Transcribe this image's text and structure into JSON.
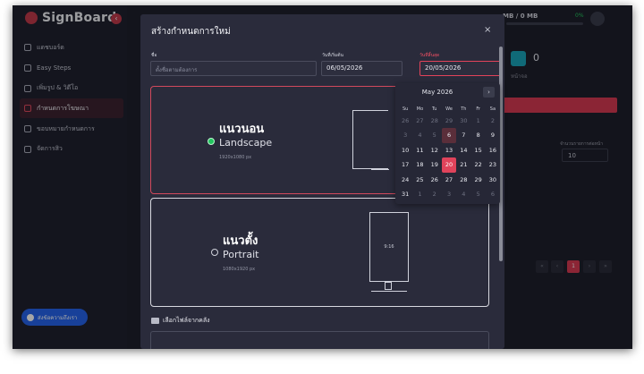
{
  "app": {
    "logo": "SignBoard"
  },
  "sidebar": {
    "items": [
      {
        "label": "แดชบอร์ด",
        "icon": "home-icon",
        "active": false
      },
      {
        "label": "Easy Steps",
        "icon": "steps-icon",
        "active": false
      },
      {
        "label": "เพิ่มรูป & วิดีโอ",
        "icon": "upload-icon",
        "active": false
      },
      {
        "label": "กำหนดการโฆษณา",
        "icon": "schedule-icon",
        "active": true
      },
      {
        "label": "ขอบหมายกำหนดการ",
        "icon": "calendar-icon",
        "active": false
      },
      {
        "label": "จัดการสิว",
        "icon": "users-icon",
        "active": false
      }
    ],
    "contact_button": "ส่งข้อความถึงเรา"
  },
  "header": {
    "storage": "MB / 0 MB",
    "storage_pct": "0%"
  },
  "background": {
    "stat_value": "0",
    "stat_label": "หน้าจอ",
    "page_size_label": "จำนวนรายการต่อหน้า",
    "page_size": "10",
    "current_page": "1"
  },
  "modal": {
    "title": "สร้างกำหนดการใหม่",
    "close": "×",
    "name_label": "ชื่อ",
    "name_placeholder": "ตั้งชื่อตามต้องการ",
    "start_label": "วันที่เริ่มต้น",
    "start_value": "06/05/2026",
    "end_label": "วันที่สิ้นสุด",
    "end_value": "20/05/2026",
    "landscape": {
      "thai": "แนวนอน",
      "english": "Landscape",
      "size": "1920x1080 px",
      "selected": true
    },
    "portrait": {
      "thai": "แนวตั้ง",
      "english": "Portrait",
      "size": "1080x1920 px",
      "ratio": "9:16",
      "selected": false
    },
    "file_section": "เลือกไฟล์จากคลัง"
  },
  "datepicker": {
    "month": "May 2026",
    "next": "›",
    "weekdays": [
      "Su",
      "Mo",
      "Tu",
      "We",
      "Th",
      "Fr",
      "Sa"
    ],
    "days": [
      {
        "d": "26",
        "muted": true
      },
      {
        "d": "27",
        "muted": true
      },
      {
        "d": "28",
        "muted": true
      },
      {
        "d": "29",
        "muted": true
      },
      {
        "d": "30",
        "muted": true
      },
      {
        "d": "1",
        "muted": true
      },
      {
        "d": "2",
        "muted": true
      },
      {
        "d": "3",
        "muted": true
      },
      {
        "d": "4",
        "muted": true
      },
      {
        "d": "5",
        "muted": true
      },
      {
        "d": "6",
        "today": true
      },
      {
        "d": "7"
      },
      {
        "d": "8"
      },
      {
        "d": "9"
      },
      {
        "d": "10"
      },
      {
        "d": "11"
      },
      {
        "d": "12"
      },
      {
        "d": "13"
      },
      {
        "d": "14"
      },
      {
        "d": "15"
      },
      {
        "d": "16"
      },
      {
        "d": "17"
      },
      {
        "d": "18"
      },
      {
        "d": "19"
      },
      {
        "d": "20",
        "selected": true
      },
      {
        "d": "21"
      },
      {
        "d": "22"
      },
      {
        "d": "23"
      },
      {
        "d": "24"
      },
      {
        "d": "25"
      },
      {
        "d": "26"
      },
      {
        "d": "27"
      },
      {
        "d": "28"
      },
      {
        "d": "29"
      },
      {
        "d": "30"
      },
      {
        "d": "31"
      },
      {
        "d": "1",
        "muted": true
      },
      {
        "d": "2",
        "muted": true
      },
      {
        "d": "3",
        "muted": true
      },
      {
        "d": "4",
        "muted": true
      },
      {
        "d": "5",
        "muted": true
      },
      {
        "d": "6",
        "muted": true
      }
    ]
  }
}
